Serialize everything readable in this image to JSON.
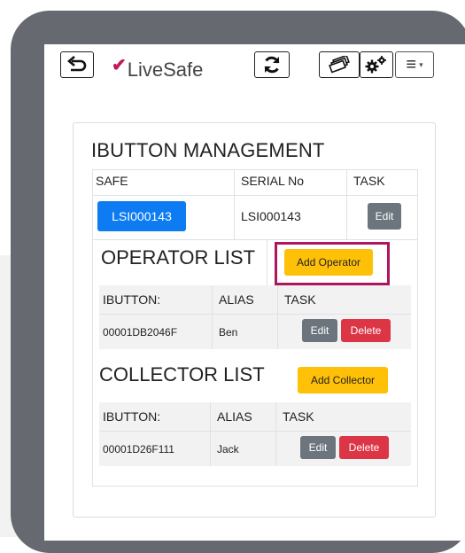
{
  "app": {
    "logo_text": "LiveSafe",
    "logo_mark": "✔",
    "menu_label": "≡",
    "menu_caret": "▾"
  },
  "page": {
    "title": "IBUTTON MANAGEMENT"
  },
  "safe_table": {
    "headers": [
      "SAFE",
      "SERIAL No",
      "TASK"
    ],
    "row": {
      "safe": "LSI000143",
      "serial": "LSI000143",
      "task_label": "Edit"
    }
  },
  "operators": {
    "title": "OPERATOR LIST",
    "add_label": "Add Operator",
    "headers": [
      "IBUTTON:",
      "ALIAS",
      "TASK"
    ],
    "rows": [
      {
        "ibutton": "00001DB2046F",
        "alias": "Ben",
        "edit_label": "Edit",
        "delete_label": "Delete"
      }
    ]
  },
  "collectors": {
    "title": "COLLECTOR LIST",
    "add_label": "Add Collector",
    "headers": [
      "IBUTTON:",
      "ALIAS",
      "TASK"
    ],
    "rows": [
      {
        "ibutton": "00001D26F111",
        "alias": "Jack",
        "edit_label": "Edit",
        "delete_label": "Delete"
      }
    ]
  },
  "colors": {
    "primary": "#0d7bf2",
    "secondary": "#6c757d",
    "danger": "#dc3545",
    "warning": "#ffc107",
    "highlight": "#b0165f",
    "device_frame": "#666a70"
  },
  "icons": [
    "back-icon",
    "refresh-icon",
    "cash-icon",
    "gears-icon",
    "menu-icon"
  ]
}
